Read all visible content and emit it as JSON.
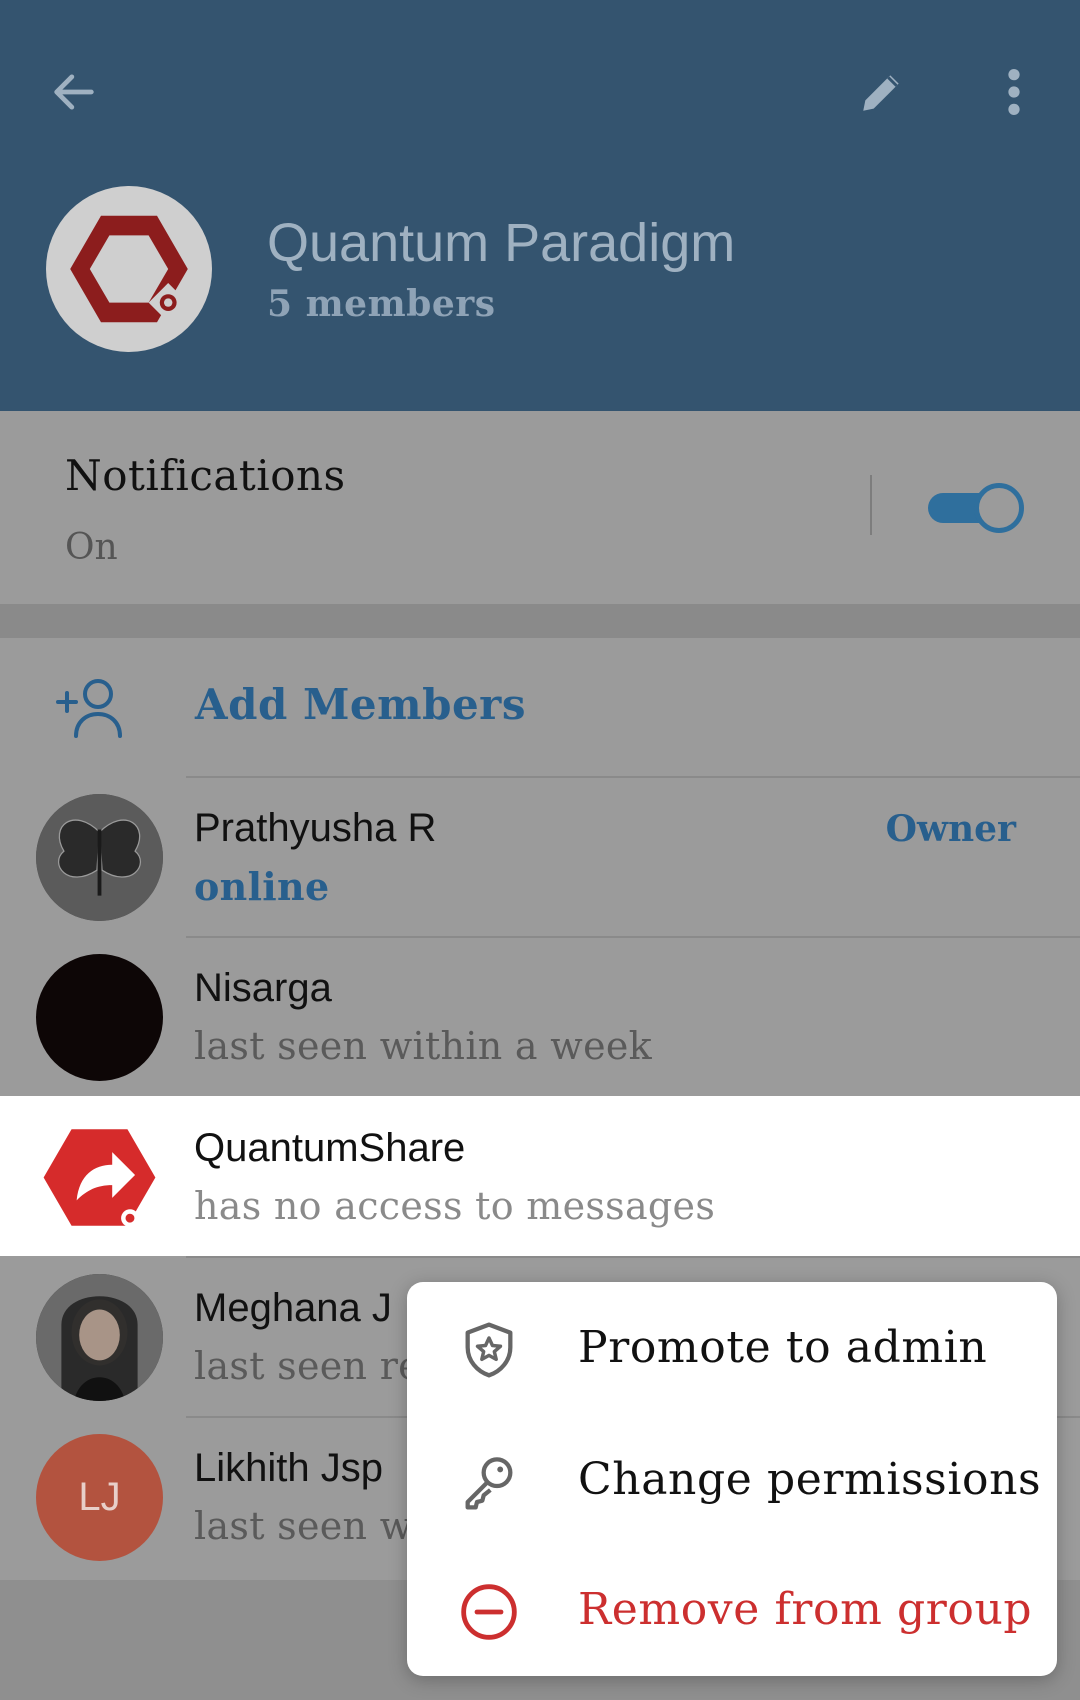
{
  "header": {
    "back_icon": "arrow-left-icon",
    "edit_icon": "pencil-icon",
    "more_icon": "more-vertical-icon",
    "group_avatar_icon": "hexagon-logo-icon",
    "title": "Quantum Paradigm",
    "subtitle": "5 members"
  },
  "notifications": {
    "title": "Notifications",
    "status": "On",
    "toggle_on": true
  },
  "add_members": {
    "icon": "add-user-icon",
    "label": "Add Members"
  },
  "members": [
    {
      "name": "Prathyusha R",
      "status": "online",
      "role": "Owner",
      "avatar": "butterfly-avatar"
    },
    {
      "name": "Nisarga",
      "status": "last seen within a week",
      "avatar": "dark-avatar"
    },
    {
      "name": "QuantumShare",
      "status": "has no access to messages",
      "avatar": "share-hexagon-icon"
    },
    {
      "name": "Meghana J",
      "status": "last seen re",
      "avatar": "photo-avatar"
    },
    {
      "name": "Likhith Jsp",
      "status": "last seen w",
      "avatar_initials": "LJ"
    }
  ],
  "context_menu": {
    "items": [
      {
        "label": "Promote to admin",
        "icon": "shield-star-icon"
      },
      {
        "label": "Change permissions",
        "icon": "key-icon"
      },
      {
        "label": "Remove from group",
        "icon": "minus-circle-icon"
      }
    ]
  },
  "colors": {
    "header_bg": "#34546f",
    "accent": "#285f8d",
    "danger": "#cc2f2f",
    "avatar_lj": "#b3533f"
  }
}
